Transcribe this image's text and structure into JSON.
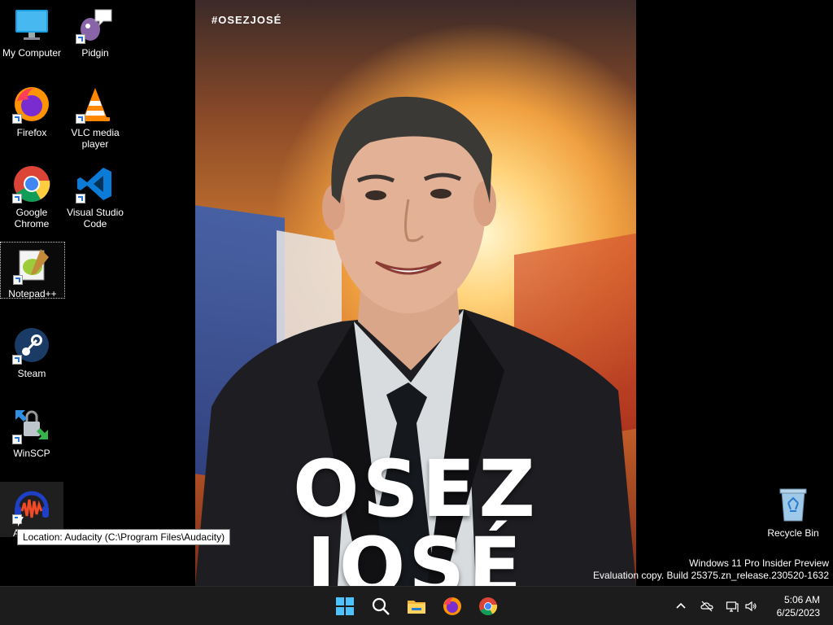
{
  "wallpaper": {
    "hashtag": "#OSEZJOSÉ",
    "slogan_line1": "OSEZ",
    "slogan_line2": "JOSÉ"
  },
  "desktop_icons": [
    {
      "label": "My Computer",
      "icon": "monitor-icon"
    },
    {
      "label": "Pidgin",
      "icon": "pidgin-icon"
    },
    {
      "label": "Firefox",
      "icon": "firefox-icon"
    },
    {
      "label": "VLC media player",
      "icon": "vlc-icon"
    },
    {
      "label": "Google Chrome",
      "icon": "chrome-icon"
    },
    {
      "label": "Visual Studio Code",
      "icon": "vscode-icon"
    },
    {
      "label": "Notepad++",
      "icon": "notepadpp-icon"
    },
    {
      "label": "Steam",
      "icon": "steam-icon"
    },
    {
      "label": "WinSCP",
      "icon": "winscp-icon"
    },
    {
      "label": "Audacity",
      "icon": "audacity-icon"
    },
    {
      "label": "Recycle Bin",
      "icon": "recycle-bin-icon"
    }
  ],
  "tooltip": "Location: Audacity (C:\\Program Files\\Audacity)",
  "watermark": {
    "line1": "Windows 11 Pro Insider Preview",
    "line2": "Evaluation copy. Build 25375.zn_release.230520-1632"
  },
  "taskbar": {
    "pinned": [
      "start-icon",
      "search-icon",
      "file-explorer-icon",
      "firefox-icon",
      "chrome-icon"
    ],
    "tray": [
      "chevron-up-icon",
      "cloud-offline-icon",
      "network-icon",
      "speaker-icon"
    ],
    "time": "5:06 AM",
    "date": "6/25/2023"
  },
  "colors": {
    "taskbar_bg": "#1c1c1c",
    "accent_blue": "#0078d4"
  }
}
